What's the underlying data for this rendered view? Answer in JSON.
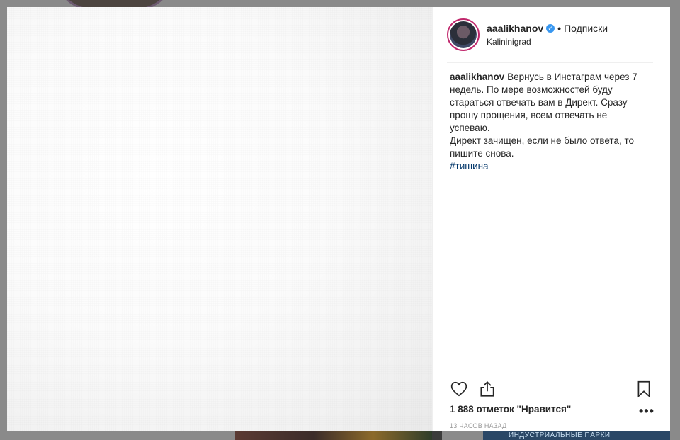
{
  "post": {
    "username": "aaalikhanov",
    "verified": true,
    "dot": "•",
    "follow_label": "Подписки",
    "location": "Kalininigrad",
    "caption": {
      "author": "aaalikhanov",
      "line1": "Вернусь в Инстаграм через 7 недель. По мере возможностей буду стараться отвечать вам в Директ. Сразу прошу прощения, всем отвечать не успеваю.",
      "line2": "Директ зачищен, если не было ответа, то пишите снова.",
      "hashtag": "#тишина"
    },
    "likes": "1 888 отметок \"Нравится\"",
    "more_label": "•••",
    "time": "13 ЧАСОВ НАЗАД"
  },
  "background": {
    "right_thumb_text": "ИНДУСТРИАЛЬНЫЕ ПАРКИ"
  },
  "icons": {
    "like": "heart-outline-icon",
    "share": "share-icon",
    "save": "bookmark-icon",
    "verified": "verified-badge-icon"
  },
  "colors": {
    "verified": "#3897f0",
    "hashtag": "#003569",
    "overlay": "#8a8a8a"
  }
}
